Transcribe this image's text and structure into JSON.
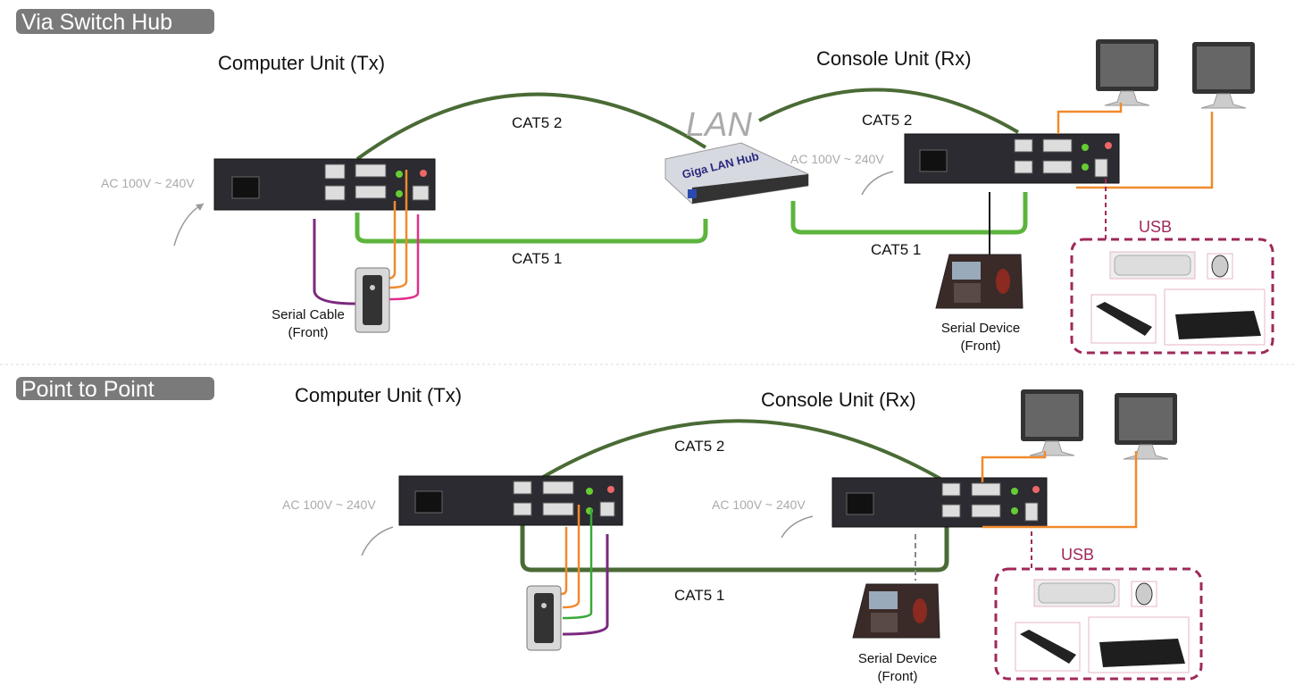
{
  "sections": [
    {
      "title": "Via Switch Hub",
      "computer_unit": "Computer Unit (Tx)",
      "console_unit": "Console Unit (Rx)",
      "ac_tx": "AC 100V ~ 240V",
      "ac_rx": "AC 100V ~ 240V",
      "cat5_2_left": "CAT5 2",
      "cat5_2_right": "CAT5 2",
      "cat5_1_left": "CAT5 1",
      "cat5_1_right": "CAT5 1",
      "lan": "LAN",
      "hub": "Giga LAN Hub",
      "serial_cable": "Serial Cable",
      "serial_cable_sub": "(Front)",
      "serial_device": "Serial Device",
      "serial_device_sub": "(Front)",
      "usb": "USB"
    },
    {
      "title": "Point to Point",
      "computer_unit": "Computer Unit (Tx)",
      "console_unit": "Console Unit (Rx)",
      "ac_tx": "AC 100V ~ 240V",
      "ac_rx": "AC 100V ~ 240V",
      "cat5_2": "CAT5 2",
      "cat5_1": "CAT5 1",
      "serial_device": "Serial Device",
      "serial_device_sub": "(Front)",
      "usb": "USB"
    }
  ],
  "colors": {
    "cat5_2": "#4a6b35",
    "cat5_1_hub": "#5cb43c",
    "cat5_1_p2p": "#4a6b35",
    "orange": "#f08a2c",
    "purple": "#7a2a7e",
    "pink": "#e0308c",
    "usb_box": "#a0285a",
    "section_pill": "#7a7a7a"
  }
}
